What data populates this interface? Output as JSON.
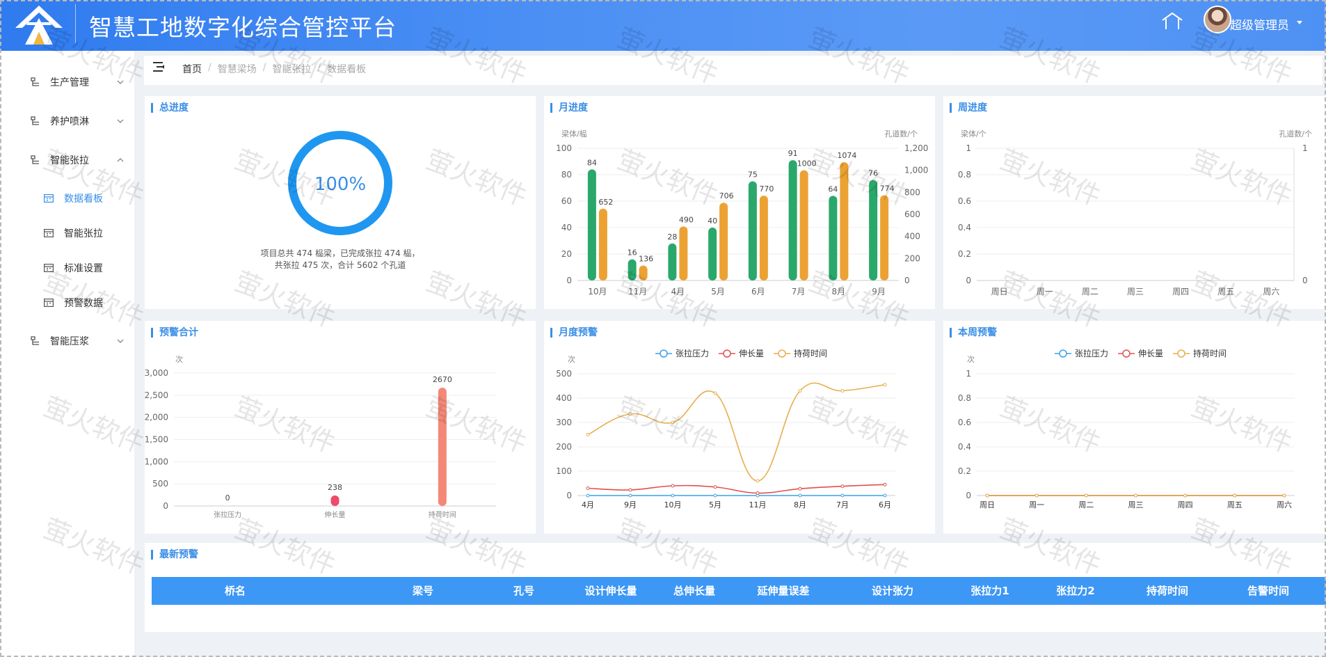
{
  "app": {
    "title": "智慧工地数字化综合管控平台",
    "user": "超级管理员"
  },
  "sidebar": {
    "items": [
      {
        "label": "生产管理",
        "expanded": false
      },
      {
        "label": "养护喷淋",
        "expanded": false
      },
      {
        "label": "智能张拉",
        "expanded": true
      },
      {
        "label": "智能压浆",
        "expanded": false
      }
    ],
    "sub_items": [
      {
        "label": "数据看板",
        "active": true
      },
      {
        "label": "智能张拉",
        "active": false
      },
      {
        "label": "标准设置",
        "active": false
      },
      {
        "label": "预警数据",
        "active": false
      }
    ]
  },
  "breadcrumb": [
    "首页",
    "智慧梁场",
    "智能张拉",
    "数据看板"
  ],
  "panels": {
    "total": {
      "title": "总进度",
      "percent": "100%",
      "progress": 1.0,
      "desc_line1": "项目总共 474 榀梁，已完成张拉 474 榀，",
      "desc_line2": "共张拉 475 次，合计 5602 个孔道"
    },
    "monthly": {
      "title": "月进度"
    },
    "weekly": {
      "title": "周进度"
    },
    "alarm_total": {
      "title": "预警合计"
    },
    "monthly_alarm": {
      "title": "月度预警"
    },
    "weekly_alarm": {
      "title": "本周预警"
    },
    "latest": {
      "title": "最新预警"
    }
  },
  "table": {
    "headers": [
      "桥名",
      "梁号",
      "孔号",
      "设计伸长量",
      "总伸长量",
      "延伸量误差",
      "设计张力",
      "张拉力1",
      "张拉力2",
      "持荷时间",
      "告警时间"
    ],
    "rows": []
  },
  "watermark": "萤火软件",
  "colors": {
    "accent": "#3a8ee6",
    "header": "#4b8ff4",
    "green": "#2aa86b",
    "orange": "#eca233",
    "ring": "#1f97f0",
    "red_bar": "#f48878",
    "pink_bar": "#ef4a6a",
    "line_blue": "#3ba1e8",
    "line_red": "#e05050",
    "line_orange": "#e9ad4f"
  },
  "chart_data": [
    {
      "id": "monthly",
      "type": "bar",
      "categories": [
        "10月",
        "11月",
        "4月",
        "5月",
        "6月",
        "7月",
        "8月",
        "9月"
      ],
      "series": [
        {
          "name": "",
          "axis": "left",
          "values": [
            84,
            16,
            28,
            40,
            75,
            91,
            64,
            76
          ]
        },
        {
          "name": "",
          "axis": "right",
          "values": [
            652,
            136,
            490,
            706,
            770,
            1000,
            1074,
            774
          ]
        }
      ],
      "ylabel": "梁体/榀",
      "ylabel_right": "孔道数/个",
      "ylim": [
        0,
        100
      ],
      "ylim_right": [
        0,
        1200
      ],
      "yticks": [
        "0",
        "20",
        "40",
        "60",
        "80",
        "100"
      ],
      "yticks_right": [
        "0",
        "200",
        "400",
        "600",
        "800",
        "1,000",
        "1,200"
      ]
    },
    {
      "id": "weekly",
      "type": "bar",
      "categories": [
        "周日",
        "周一",
        "周二",
        "周三",
        "周四",
        "周五",
        "周六"
      ],
      "series": [],
      "ylabel": "梁体/个",
      "ylabel_right": "孔道数/个",
      "ylim": [
        0,
        1
      ],
      "ylim_right": [
        0,
        1
      ],
      "yticks": [
        "0",
        "0.2",
        "0.4",
        "0.6",
        "0.8",
        "1"
      ],
      "yticks_right": [
        "0",
        "1"
      ]
    },
    {
      "id": "alarm_total",
      "type": "bar",
      "categories": [
        "张拉压力",
        "伸长量",
        "持荷时间"
      ],
      "values": [
        0,
        238,
        2670
      ],
      "labels": [
        "0",
        "238",
        "2670"
      ],
      "ylabel": "次",
      "ylim": [
        0,
        3000
      ],
      "yticks": [
        "0",
        "500",
        "1,000",
        "1,500",
        "2,000",
        "2,500",
        "3,000"
      ]
    },
    {
      "id": "monthly_alarm",
      "type": "line",
      "categories": [
        "4月",
        "9月",
        "10月",
        "5月",
        "11月",
        "8月",
        "7月",
        "6月"
      ],
      "series": [
        {
          "name": "张拉压力",
          "values": [
            0,
            0,
            0,
            0,
            0,
            0,
            0,
            0
          ]
        },
        {
          "name": "伸长量",
          "values": [
            30,
            23,
            40,
            35,
            10,
            28,
            38,
            45
          ]
        },
        {
          "name": "持荷时间",
          "values": [
            250,
            335,
            300,
            420,
            60,
            430,
            430,
            455
          ]
        }
      ],
      "ylabel": "次",
      "ylim": [
        0,
        500
      ],
      "yticks": [
        "0",
        "100",
        "200",
        "300",
        "400",
        "500"
      ],
      "legend": "top-center"
    },
    {
      "id": "weekly_alarm",
      "type": "line",
      "categories": [
        "周日",
        "周一",
        "周二",
        "周三",
        "周四",
        "周五",
        "周六"
      ],
      "series": [
        {
          "name": "张拉压力",
          "values": [
            0,
            0,
            0,
            0,
            0,
            0,
            0
          ]
        },
        {
          "name": "伸长量",
          "values": [
            0,
            0,
            0,
            0,
            0,
            0,
            0
          ]
        },
        {
          "name": "持荷时间",
          "values": [
            0,
            0,
            0,
            0,
            0,
            0,
            0
          ]
        }
      ],
      "ylabel": "次",
      "ylim": [
        0,
        1
      ],
      "yticks": [
        "0",
        "0.2",
        "0.4",
        "0.6",
        "0.8",
        "1"
      ],
      "legend": "top-center"
    }
  ]
}
